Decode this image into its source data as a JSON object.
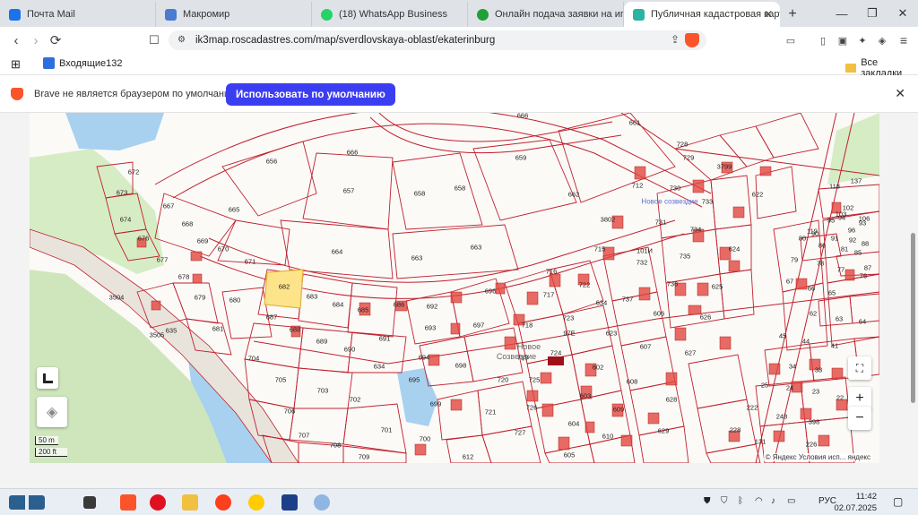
{
  "tabs": [
    {
      "title": "Почта Mail",
      "icon": "mail-icon",
      "color": "#1a73e8"
    },
    {
      "title": "Макромир",
      "icon": "building-icon",
      "color": "#4a7bd0"
    },
    {
      "title": "(18) WhatsApp Business",
      "icon": "whatsapp-icon",
      "color": "#25d366"
    },
    {
      "title": "Онлайн подача заявки на ипоте",
      "icon": "domclick-icon",
      "color": "#21a038"
    },
    {
      "title": "Публичная кадастровая карт",
      "icon": "cadastre-icon",
      "color": "#2bb5a0",
      "active": true
    }
  ],
  "address": {
    "url": "ik3map.roscadastres.com/map/sverdlovskaya-oblast/ekaterinburg",
    "shield_count": "4"
  },
  "bookmarks": {
    "inbox": "Входящие132",
    "all": "Все закладки"
  },
  "banner": {
    "message": "Brave не является браузером по умолчанию.",
    "button": "Использовать по умолчанию"
  },
  "map": {
    "labels": {
      "l666a": "666",
      "l666b": "666",
      "l661": "661",
      "l728": "728",
      "l729": "729",
      "l3799": "3799",
      "l659": "659",
      "l656": "656",
      "l657": "657",
      "l658a": "658",
      "l658b": "658",
      "l662": "662",
      "l672": "672",
      "l673": "673",
      "l674": "674",
      "l667": "667",
      "l665": "665",
      "l668": "668",
      "l669": "669",
      "l670": "670",
      "l676": "676",
      "l664": "664",
      "l663a": "663",
      "l663b": "663",
      "l671": "671",
      "l677": "677",
      "l678": "678",
      "l679": "679",
      "l680": "680",
      "l681": "681",
      "l682": "682",
      "l683": "683",
      "l684": "684",
      "l685": "685",
      "l686": "686",
      "l687": "687",
      "l688": "688",
      "l689": "689",
      "l690": "690",
      "l691": "691",
      "l692": "692",
      "l693": "693",
      "l695": "695",
      "l696": "696",
      "l697": "697",
      "l698": "698",
      "l694": "694",
      "l716": "716",
      "l717": "717",
      "l718": "718",
      "l722": "722",
      "l723": "723",
      "l715": "715",
      "l737": "737",
      "l712": "712",
      "l730": "730",
      "l733": "733",
      "l731": "731",
      "l734": "734",
      "l735": "735",
      "l736": "736",
      "l732": "732",
      "l3802": "3802",
      "l624": "624",
      "l625": "625",
      "l626": "626",
      "l627": "627",
      "l622": "622",
      "l623": "623",
      "l606": "606",
      "l607": "607",
      "l608": "608",
      "l609": "609",
      "l610": "610",
      "l602": "602",
      "l603": "603",
      "l604": "604",
      "l605": "605",
      "l628": "628",
      "l629": "629",
      "l719": "719",
      "l720": "720",
      "l721": "721",
      "l724": "724",
      "l725": "725",
      "l726": "726",
      "l727": "727",
      "l704": "704",
      "l705": "705",
      "l706": "706",
      "l707": "707",
      "l708": "708",
      "l709": "709",
      "l703": "703",
      "l702": "702",
      "l701": "701",
      "l700": "700",
      "l699": "699",
      "l612": "612",
      "l634a": "634",
      "l634b": "634",
      "l635": "635",
      "l3504": "3504",
      "l3505": "3505",
      "l118": "118",
      "l137": "137",
      "l1011": "101И",
      "l97e": "97Е",
      "l222": "222",
      "l248": "248",
      "l228": "228",
      "l226": "226",
      "l398": "398",
      "l131": "131",
      "l25": "25",
      "l24": "24",
      "l23": "23",
      "l22": "22",
      "l34": "34",
      "l33": "33",
      "l44": "44",
      "l45": "45",
      "l41": "41",
      "l65": "65",
      "l67": "67",
      "l66": "66",
      "l62": "62",
      "l63": "63",
      "l64": "64",
      "l79": "79",
      "l78": "78",
      "l77": "77",
      "l76": "76",
      "l80": "80",
      "l81": "81",
      "l85": "85",
      "l86": "86",
      "l87": "87",
      "l88": "88",
      "l90": "90",
      "l91": "91",
      "l92": "92",
      "l93": "93",
      "l94": "94",
      "l95": "95",
      "l96": "96",
      "l103": "103",
      "l102": "102",
      "l106": "106",
      "l119": "119"
    },
    "place_names": {
      "novoe": "Новое созвездие",
      "sozv": "Созвездие",
      "novoe2": "Новое"
    },
    "scale_m": "50 m",
    "scale_ft": "200 ft",
    "attribution": "© Яндекс Условия исп... яндекс",
    "zoom_in": "+",
    "zoom_out": "−"
  },
  "colors": {
    "parcel_line": "#c0202e",
    "selected_fill": "#fde48a",
    "water": "#a8d1f0",
    "green": "#d6ecc4",
    "building": "#e2463f",
    "brave": "#fb542b",
    "accent": "#3b3ef0"
  },
  "taskbar": {
    "lang": "РУС",
    "time": "11:42",
    "date": "02.07.2025"
  }
}
